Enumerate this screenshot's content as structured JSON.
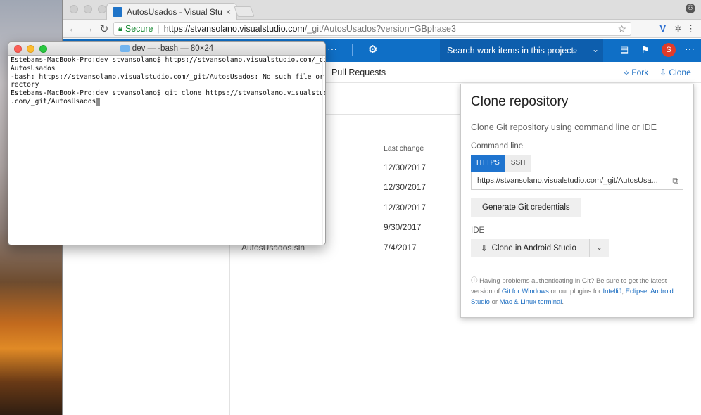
{
  "browser": {
    "tab_title": "AutosUsados - Visual Studio T",
    "tab_close": "×",
    "nav": {
      "back": "←",
      "forward": "→",
      "reload": "↻"
    },
    "secure_label": "Secure",
    "url_main": "https://stvansolano.visualstudio.com",
    "url_rest": "/_git/AutosUsados?version=GBphase3",
    "star": "☆",
    "profile": "⚇"
  },
  "appbar": {
    "dots": "···",
    "gear": "⚙",
    "search_placeholder": "Search work items in this project",
    "search_icon": "⌕",
    "chevron": "⌄",
    "avatar_letter": "S",
    "more": "···"
  },
  "subnav": {
    "pull_requests": "Pull Requests",
    "fork": "Fork",
    "clone": "Clone"
  },
  "files": {
    "col_last_change": "Last change",
    "dates": [
      "12/30/2017",
      "12/30/2017",
      "12/30/2017",
      "9/30/2017",
      "7/4/2017"
    ],
    "sln_name": "AutosUsados.sln"
  },
  "clone_panel": {
    "title": "Clone repository",
    "subtitle": "Clone Git repository using command line or IDE",
    "command_line_label": "Command line",
    "https_tab": "HTTPS",
    "ssh_tab": "SSH",
    "clone_url": "https://stvansolano.visualstudio.com/_git/AutosUsa...",
    "generate_credentials": "Generate Git credentials",
    "ide_label": "IDE",
    "ide_button": "Clone in Android Studio",
    "help_prefix": "Having problems authenticating in Git? Be sure to get the latest version of",
    "help_link1": "Git for Windows",
    "help_mid": "or our plugins for",
    "help_link2": "IntelliJ",
    "help_link3": "Eclipse",
    "help_link4": "Android Studio",
    "help_or": "or",
    "help_link5": "Mac & Linux terminal",
    "help_end": "."
  },
  "terminal": {
    "title": "dev — -bash — 80×24",
    "lines": [
      "Estebans-MacBook-Pro:dev stvansolano$ https://stvansolano.visualstudio.com/_git/",
      "AutosUsados",
      "-bash: https://stvansolano.visualstudio.com/_git/AutosUsados: No such file or di",
      "rectory",
      "Estebans-MacBook-Pro:dev stvansolano$ git clone https://stvansolano.visualstudio",
      ".com/_git/AutosUsados"
    ]
  }
}
